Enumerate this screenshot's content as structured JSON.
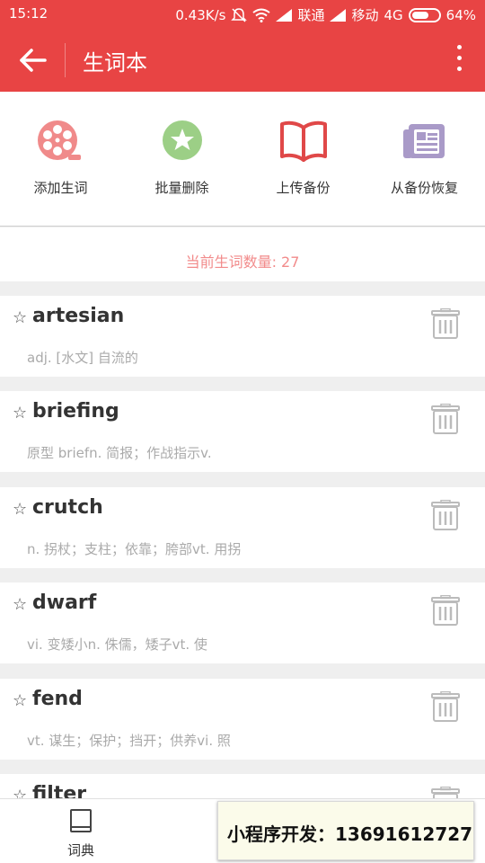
{
  "status": {
    "time": "15:12",
    "speed": "0.43K/s",
    "carrier1": "联通",
    "carrier2": "移动",
    "network": "4G",
    "battery": "64%",
    "battery_level": 0.64
  },
  "appbar": {
    "title": "生词本",
    "back_icon": "arrow-left-icon",
    "more_icon": "more-vertical-icon",
    "color": "#e84444"
  },
  "tools": [
    {
      "label": "添加生词",
      "icon": "film-reel-icon",
      "color": "#f08a8a"
    },
    {
      "label": "批量删除",
      "icon": "star-badge-icon",
      "color": "#9ccf86"
    },
    {
      "label": "上传备份",
      "icon": "open-book-icon",
      "color": "#e04848"
    },
    {
      "label": "从备份恢复",
      "icon": "newspaper-icon",
      "color": "#a99ac8"
    }
  ],
  "count_text": "当前生词数量: 27",
  "words": [
    {
      "word": "artesian",
      "definition": "adj. [水文] 自流的"
    },
    {
      "word": "briefing",
      "definition": "原型 briefn. 简报；作战指示v."
    },
    {
      "word": "crutch",
      "definition": "n. 拐杖；支柱；依靠；胯部vt. 用拐"
    },
    {
      "word": "dwarf",
      "definition": "vi. 变矮小n. 侏儒，矮子vt. 使"
    },
    {
      "word": "fend",
      "definition": "vt. 谋生；保护；挡开；供养vi. 照"
    },
    {
      "word": "filter",
      "definition": ""
    }
  ],
  "bottom_nav": {
    "dict_label": "词典",
    "dict_icon": "book-icon"
  },
  "ad_text": "小程序开发：13691612727"
}
